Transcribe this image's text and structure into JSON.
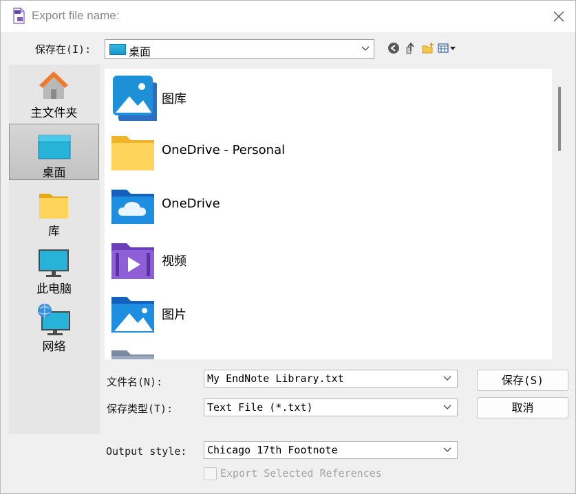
{
  "window": {
    "title": "Export file name:"
  },
  "save_in": {
    "label": "保存在(I):",
    "value": "桌面"
  },
  "places": [
    {
      "label": "主文件夹",
      "icon": "home-icon"
    },
    {
      "label": "桌面",
      "icon": "desktop-icon",
      "selected": true
    },
    {
      "label": "库",
      "icon": "library-icon"
    },
    {
      "label": "此电脑",
      "icon": "computer-icon"
    },
    {
      "label": "网络",
      "icon": "network-icon"
    }
  ],
  "files": [
    {
      "name": "图库",
      "icon": "gallery-icon"
    },
    {
      "name": "OneDrive - Personal",
      "icon": "folder-icon"
    },
    {
      "name": "OneDrive",
      "icon": "onedrive-folder-icon"
    },
    {
      "name": "视频",
      "icon": "videos-folder-icon"
    },
    {
      "name": "图片",
      "icon": "pictures-folder-icon"
    }
  ],
  "filename": {
    "label": "文件名(N):",
    "value": "My EndNote Library.txt"
  },
  "filetype": {
    "label": "保存类型(T):",
    "value": "Text File (*.txt)"
  },
  "output_style": {
    "label": "Output style:",
    "value": "Chicago 17th Footnote"
  },
  "export_selected": {
    "label": "Export Selected References",
    "checked": false
  },
  "buttons": {
    "save": "保存(S)",
    "cancel": "取消"
  },
  "colors": {
    "accent": "#1e90d8",
    "folder_yellow": "#ffd45a",
    "selected_place": "#c8c8c8"
  }
}
